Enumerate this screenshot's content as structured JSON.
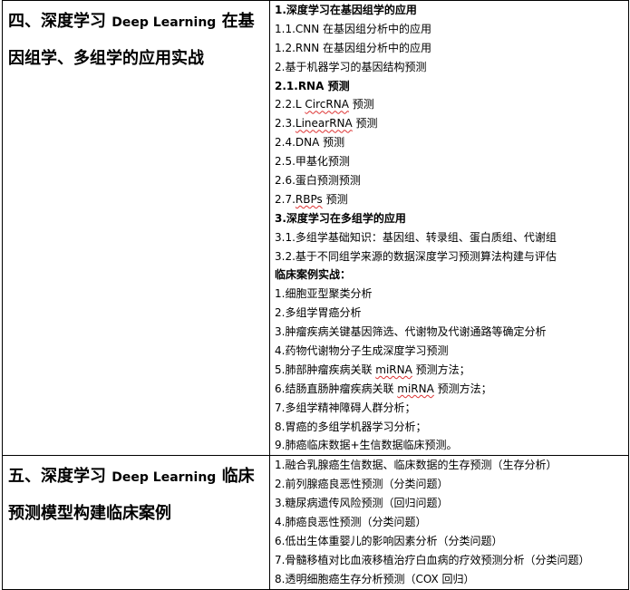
{
  "section4": {
    "title_pre": "四、深度学习 ",
    "title_latin": "Deep Learning",
    "title_post": " 在基因组学、多组学的应用实战",
    "lines": [
      {
        "text": "1.深度学习在基因组学的应用",
        "bold": true
      },
      {
        "text": "1.1.CNN 在基因组分析中的应用"
      },
      {
        "text": "1.2.RNN 在基因组分析中的应用"
      },
      {
        "text": "2.基于机器学习的基因结构预测"
      },
      {
        "text": "2.1.RNA 预测",
        "bold": true
      },
      {
        "pre": "2.2.L ",
        "wavy": "CircRNA",
        "post": " 预测"
      },
      {
        "pre": "2.3.",
        "wavy": "LinearRNA",
        "post": " 预测"
      },
      {
        "text": "2.4.DNA 预测"
      },
      {
        "text": "2.5.甲基化预测"
      },
      {
        "text": "2.6.蛋白预测预测"
      },
      {
        "pre": "2.7.",
        "wavy": "RBPs",
        "post": " 预测"
      },
      {
        "text": "3.深度学习在多组学的应用",
        "bold": true
      },
      {
        "text": "3.1.多组学基础知识：基因组、转录组、蛋白质组、代谢组"
      },
      {
        "text": "3.2.基于不同组学来源的数据深度学习预测算法构建与评估"
      },
      {
        "text": "临床案例实战：",
        "bold": true
      },
      {
        "text": "1.细胞亚型聚类分析"
      },
      {
        "text": "2.多组学胃癌分析"
      },
      {
        "text": "3.肿瘤疾病关键基因筛选、代谢物及代谢通路等确定分析"
      },
      {
        "text": "4.药物代谢物分子生成深度学习预测"
      },
      {
        "pre": "5.肺部肿瘤疾病关联 ",
        "wavy": "miRNA",
        "post": " 预测方法；"
      },
      {
        "pre": "6.结肠直肠肿瘤疾病关联 ",
        "wavy": "miRNA",
        "post": " 预测方法；"
      },
      {
        "text": "7.多组学精神障碍人群分析；"
      },
      {
        "text": "8.胃癌的多组学机器学习分析；"
      },
      {
        "text": "9.肺癌临床数据+生信数据临床预测。"
      }
    ]
  },
  "section5": {
    "title_pre": "五、深度学习 ",
    "title_latin": "Deep Learning",
    "title_post": " 临床预测模型构建临床案例",
    "lines": [
      {
        "text": "1.融合乳腺癌生信数据、临床数据的生存预测（生存分析）"
      },
      {
        "text": "2.前列腺癌良恶性预测（分类问题）"
      },
      {
        "text": "3.糖尿病遗传风险预测（回归问题）"
      },
      {
        "text": "4.肺癌良恶性预测（分类问题）"
      },
      {
        "text": "6.低出生体重婴儿的影响因素分析（分类问题）"
      },
      {
        "text": "7.骨髓移植对比血液移植治疗白血病的疗效预测分析（分类问题）"
      },
      {
        "text": "8.透明细胞癌生存分析预测（COX 回归）"
      }
    ]
  }
}
